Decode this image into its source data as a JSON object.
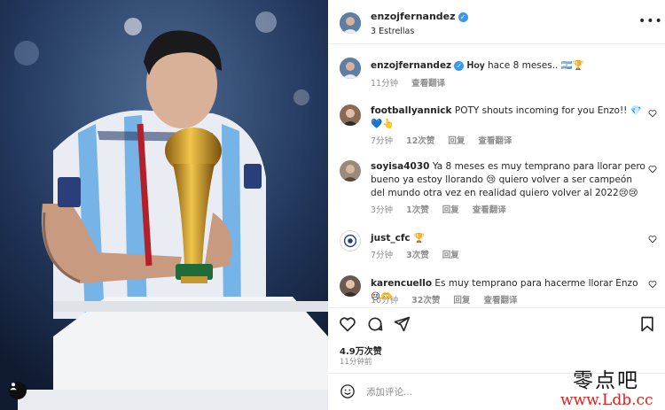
{
  "post": {
    "username": "enzojfernandez",
    "subtitle": "3 Estrellas",
    "more_icon": "more-horizontal-icon"
  },
  "caption": {
    "username": "enzojfernandez",
    "text": "𝐇𝐨𝐲 hace 8 meses.. 🇦🇷🏆",
    "time": "11分钟",
    "translate": "查看翻译"
  },
  "comments": [
    {
      "username": "footballyannick",
      "text": "POTY shouts incoming for you Enzo!! 💎💙👆",
      "time": "7分钟",
      "likes": "12次赞",
      "reply": "回复",
      "translate": "查看翻译"
    },
    {
      "username": "soyisa4030",
      "text": "Ya 8 meses es muy temprano para llorar pero bueno ya estoy llorando 😢 quiero volver a ser campeón del mundo otra vez en realidad quiero volver al 2022😢😢",
      "time": "3分钟",
      "likes": "1次赞",
      "reply": "回复",
      "translate": "查看翻译"
    },
    {
      "username": "just_cfc",
      "text": "🏆",
      "time": "7分钟",
      "likes": "3次赞",
      "reply": "回复",
      "translate": ""
    },
    {
      "username": "karencuello",
      "text": "Es muy temprano para hacerme llorar Enzo 😢🫶",
      "time": "10分钟",
      "likes": "32次赞",
      "reply": "回复",
      "translate": "查看翻译"
    }
  ],
  "actions": {
    "icons": [
      "heart-icon",
      "comment-icon",
      "share-icon",
      "bookmark-icon"
    ],
    "likes_count": "4.9万次赞",
    "time_ago": "11分钟前"
  },
  "add_comment": {
    "placeholder": "添加评论..."
  },
  "watermark": {
    "chinese": "零点吧",
    "url": "www.Ldb.cc"
  },
  "colors": {
    "verified": "#3897f0",
    "meta_grey": "#8e8e8e",
    "text": "#262626",
    "watermark_red": "#e0201c"
  }
}
